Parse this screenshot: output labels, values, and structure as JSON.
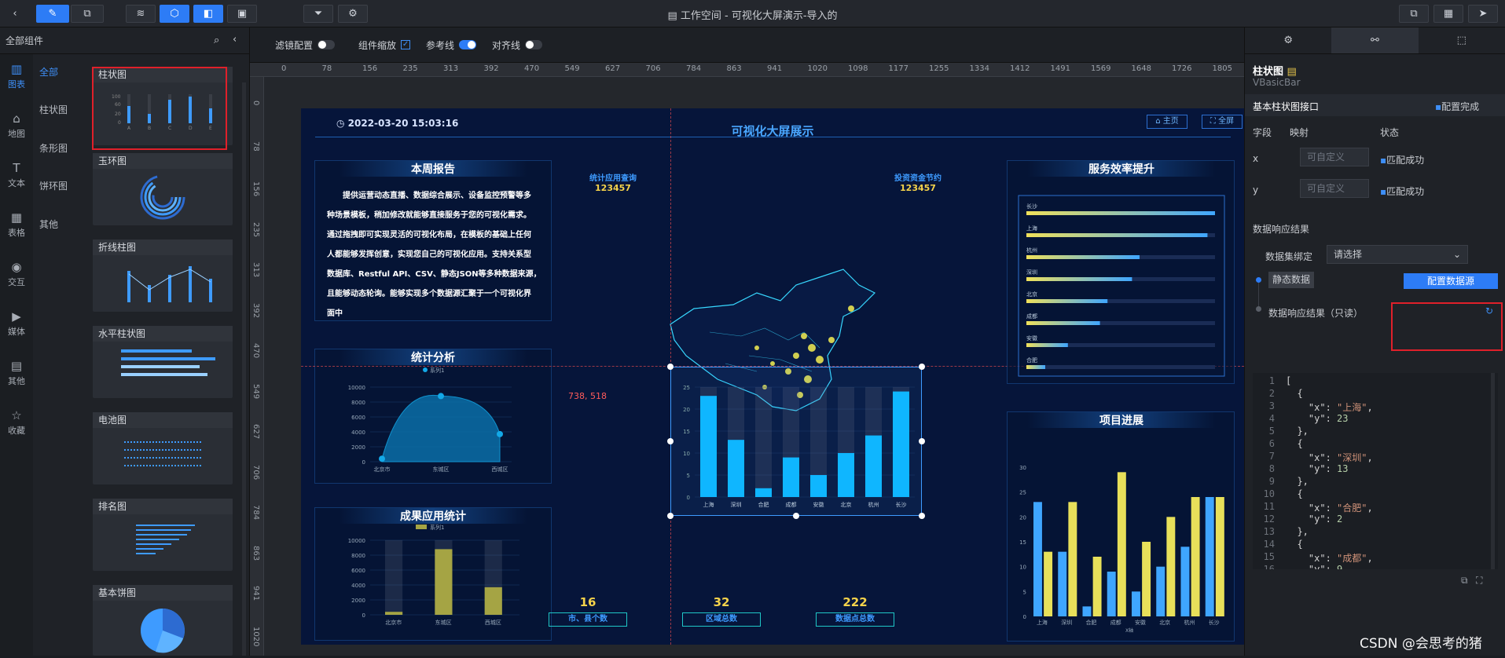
{
  "window": {
    "title": "工作空间 - 可视化大屏演示-导入的"
  },
  "left": {
    "header": "全部组件",
    "rail": [
      "图表",
      "地图",
      "文本",
      "表格",
      "交互",
      "媒体",
      "其他",
      "收藏"
    ],
    "sub": [
      "全部",
      "柱状图",
      "条形图",
      "饼环图",
      "其他"
    ],
    "cards": [
      "柱状图",
      "玉环图",
      "折线柱图",
      "水平柱状图",
      "电池图",
      "排名图",
      "基本饼图"
    ],
    "card_axis": [
      "A",
      "B",
      "C",
      "D",
      "E",
      "F"
    ]
  },
  "toolbar": {
    "filter": "滤镜配置",
    "zoom": "组件缩放",
    "ref": "参考线",
    "align": "对齐线"
  },
  "ruler": {
    "top": [
      "0",
      "78",
      "156",
      "235",
      "313",
      "392",
      "470",
      "549",
      "627",
      "706",
      "784",
      "863",
      "941",
      "1020",
      "1098",
      "1177",
      "1255",
      "1334",
      "1412",
      "1491",
      "1569",
      "1648",
      "1726",
      "1805"
    ],
    "left": [
      "0",
      "78",
      "156",
      "235",
      "313",
      "392",
      "470",
      "549",
      "627",
      "706",
      "784",
      "863",
      "941",
      "1020"
    ]
  },
  "screen": {
    "datetime": "2022-03-20 15:03:16",
    "title": "可视化大屏展示",
    "home": "主页",
    "full": "全屏",
    "coord": "738, 518",
    "report": {
      "title": "本周报告",
      "lines": [
        "提供运营动态直播、数据综合展示、设备监控预警等多",
        "种场景模板，稍加修改就能够直接服务于您的可视化需求。",
        "通过拖拽即可实现灵活的可视化布局，在模板的基础上任何",
        "人都能够发挥创意，实现您自己的可视化应用。支持关系型",
        "数据库、Restful API、CSV、静态JSON等多种数据来源，",
        "且能够动态轮询。能够实现多个数据源汇聚于一个可视化界",
        "面中"
      ]
    },
    "stat1": {
      "label": "统计应用查询",
      "value": "123457"
    },
    "stat2": {
      "label": "投资资金节约",
      "value": "123457"
    },
    "analysis_title": "统计分析",
    "results_title": "成果应用统计",
    "service_title": "服务效率提升",
    "progress_title": "项目进展",
    "kpis": [
      {
        "value": "16",
        "label": "市、县个数"
      },
      {
        "value": "32",
        "label": "区域总数"
      },
      {
        "value": "222",
        "label": "数据点总数"
      }
    ]
  },
  "right": {
    "name": "柱状图",
    "sub": "VBasicBar",
    "section": "基本柱状图接口",
    "status": "配置完成",
    "col_field": "字段",
    "col_map": "映射",
    "col_state": "状态",
    "rows": [
      {
        "field": "x",
        "placeholder": "可自定义",
        "state": "匹配成功"
      },
      {
        "field": "y",
        "placeholder": "可自定义",
        "state": "匹配成功"
      }
    ],
    "result_title": "数据响应结果",
    "bind_label": "数据集绑定",
    "bind_value": "请选择",
    "static_btn": "静态数据",
    "config_btn": "配置数据源",
    "readonly": "数据响应结果（只读）",
    "code": [
      "[",
      "  {",
      "    \"x\": \"上海\",",
      "    \"y\": 23",
      "  },",
      "  {",
      "    \"x\": \"深圳\",",
      "    \"y\": 13",
      "  },",
      "  {",
      "    \"x\": \"合肥\",",
      "    \"y\": 2",
      "  },",
      "  {",
      "    \"x\": \"成都\",",
      "    \"y\": 9",
      "  },"
    ]
  },
  "watermark": "CSDN @会思考的猪",
  "chart_data": [
    {
      "type": "bar",
      "categories": [
        "上海",
        "深圳",
        "合肥",
        "成都",
        "安徽",
        "北京",
        "杭州",
        "长沙"
      ],
      "values": [
        23,
        13,
        2,
        9,
        5,
        10,
        14,
        24
      ],
      "ylim": [
        0,
        25
      ]
    },
    {
      "type": "area",
      "categories": [
        "北京市",
        "东城区",
        "西城区"
      ],
      "values": [
        400,
        8800,
        3700
      ],
      "ylim": [
        0,
        10000
      ],
      "legend": "系列1"
    },
    {
      "type": "bar",
      "categories": [
        "北京市",
        "东城区",
        "西城区"
      ],
      "values": [
        400,
        8800,
        3700
      ],
      "ylim": [
        0,
        10000
      ],
      "legend": "系列1"
    },
    {
      "type": "bar",
      "categories": [
        "长沙",
        "上海",
        "杭州",
        "深圳",
        "北京",
        "成都",
        "安徽",
        "合肥"
      ],
      "values": [
        100,
        96,
        60,
        56,
        43,
        39,
        22,
        10
      ],
      "orientation": "horizontal"
    },
    {
      "type": "bar",
      "categories": [
        "上海",
        "深圳",
        "合肥",
        "成都",
        "安徽",
        "北京",
        "杭州",
        "长沙"
      ],
      "series": [
        {
          "values": [
            23,
            13,
            2,
            9,
            5,
            10,
            14,
            24
          ]
        },
        {
          "values": [
            13,
            23,
            12,
            29,
            15,
            20,
            24,
            24
          ]
        }
      ],
      "ylim": [
        0,
        30
      ],
      "xlabel": "X轴"
    }
  ]
}
